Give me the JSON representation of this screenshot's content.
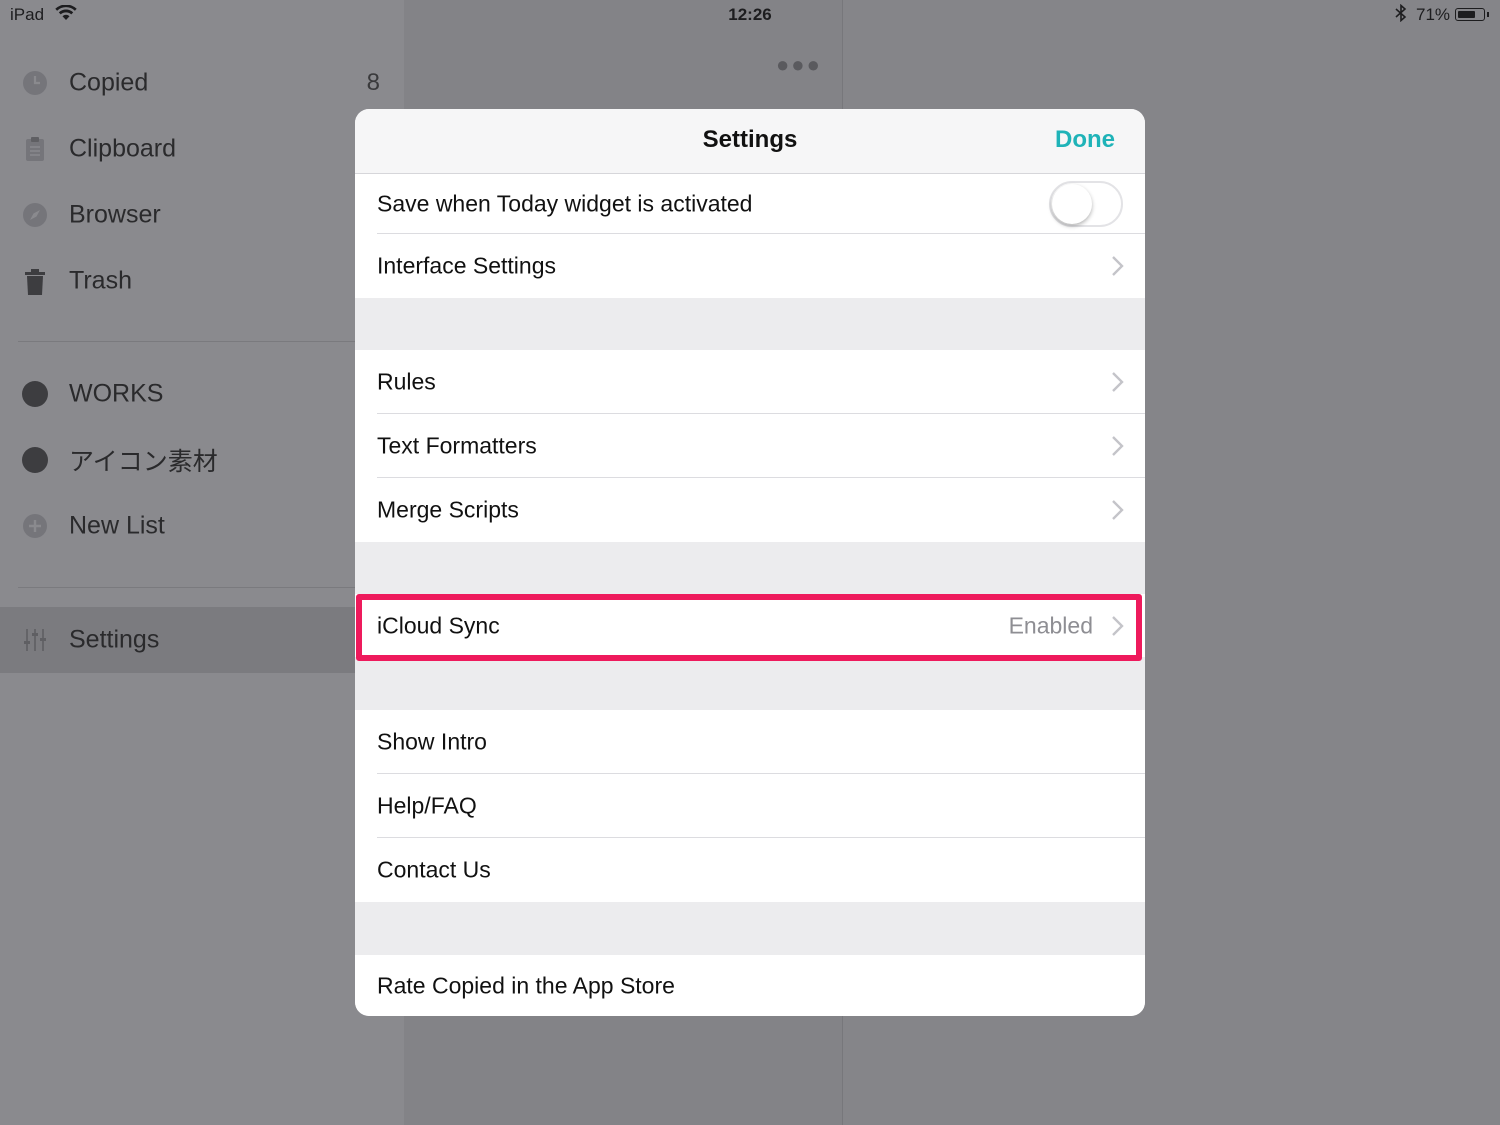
{
  "status_bar": {
    "carrier": "iPad",
    "time": "12:26",
    "battery_text": "71%",
    "battery_level": 0.71
  },
  "sidebar": {
    "items": [
      {
        "label": "Copied",
        "count": "8",
        "icon": "clock-icon"
      },
      {
        "label": "Clipboard",
        "icon": "clipboard-icon"
      },
      {
        "label": "Browser",
        "icon": "compass-icon"
      },
      {
        "label": "Trash",
        "icon": "trash-icon"
      }
    ],
    "lists": [
      {
        "label": "WORKS",
        "icon": "list-dot-icon"
      },
      {
        "label": "アイコン素材",
        "icon": "list-dot-icon"
      },
      {
        "label": "New List",
        "icon": "plus-circle-icon"
      }
    ],
    "settings": {
      "label": "Settings",
      "icon": "sliders-icon"
    }
  },
  "modal": {
    "title": "Settings",
    "done_label": "Done",
    "accent_color": "#1fb3b8",
    "highlight_color": "#ee1a5c",
    "rows": {
      "save_widget": {
        "label": "Save when Today widget is activated",
        "toggle_on": false
      },
      "interface": {
        "label": "Interface Settings"
      },
      "rules": {
        "label": "Rules"
      },
      "formatters": {
        "label": "Text Formatters"
      },
      "merge": {
        "label": "Merge Scripts"
      },
      "icloud": {
        "label": "iCloud Sync",
        "detail": "Enabled"
      },
      "intro": {
        "label": "Show Intro"
      },
      "help": {
        "label": "Help/FAQ"
      },
      "contact": {
        "label": "Contact Us"
      },
      "rate": {
        "label": "Rate Copied in the App Store"
      }
    }
  }
}
